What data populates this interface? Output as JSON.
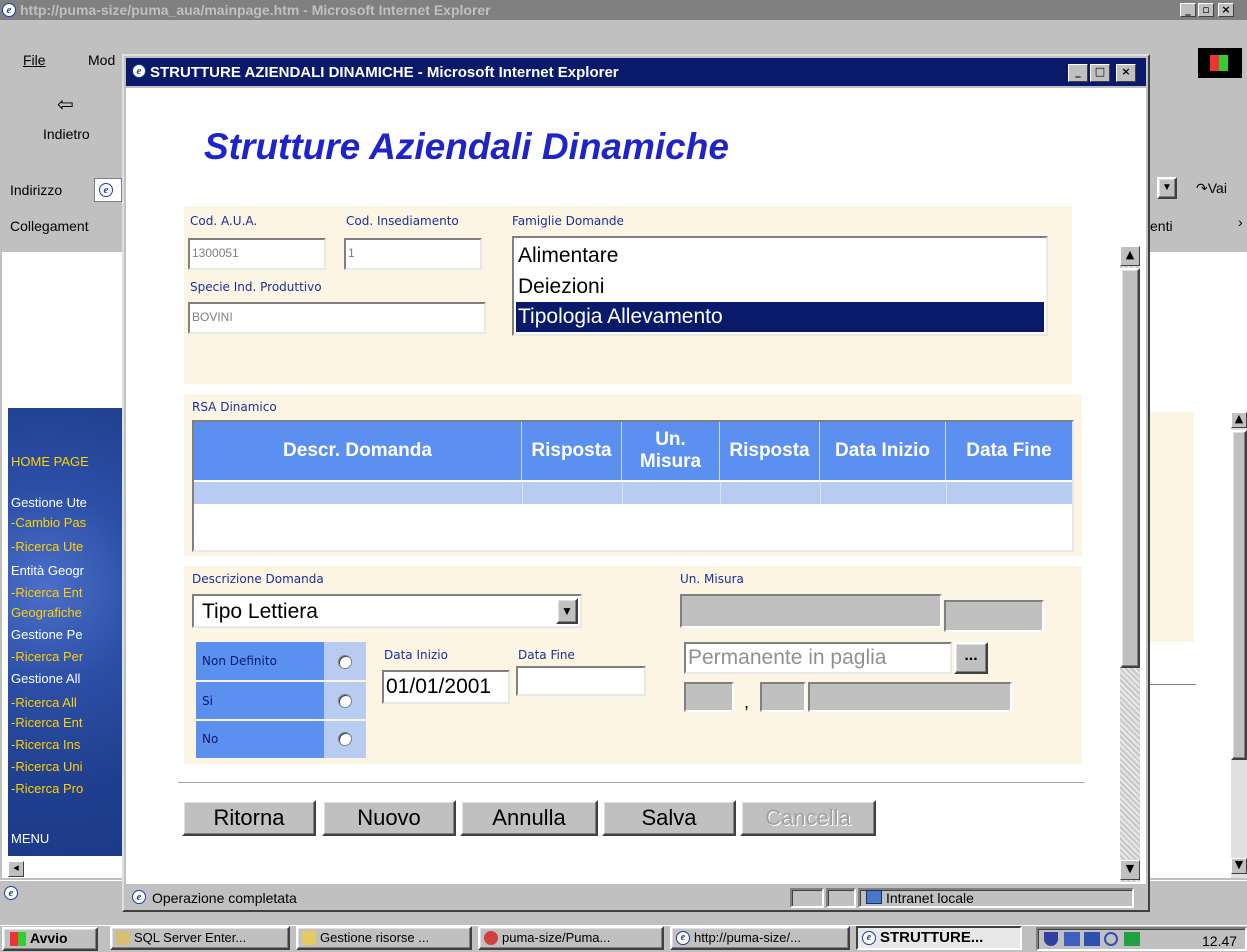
{
  "parent": {
    "title": "http://puma-size/puma_aua/mainpage.htm - Microsoft Internet Explorer",
    "menu_file": "File",
    "menu_mod": "Mod",
    "back_label": "Indietro",
    "address_label": "Indirizzo",
    "links_label": "Collegament",
    "links_right": "enti",
    "go_label": "Vai",
    "status_right": "12.47"
  },
  "sidebar": {
    "home": "HOME PAGE",
    "items": [
      {
        "text": "Gestione Ute",
        "kind": "text"
      },
      {
        "text": "-Cambio Pas",
        "kind": "link"
      },
      {
        "text": "-Ricerca Ute",
        "kind": "link"
      },
      {
        "text": "Entità Geogr",
        "kind": "text"
      },
      {
        "text": "-Ricerca Ent",
        "kind": "link"
      },
      {
        "text": "Geografiche",
        "kind": "link"
      },
      {
        "text": "Gestione Pe",
        "kind": "text"
      },
      {
        "text": "-Ricerca Per",
        "kind": "link"
      },
      {
        "text": "Gestione All",
        "kind": "text"
      },
      {
        "text": "-Ricerca All",
        "kind": "link"
      },
      {
        "text": "-Ricerca Ent",
        "kind": "link"
      },
      {
        "text": "-Ricerca Ins",
        "kind": "link"
      },
      {
        "text": "-Ricerca Uni",
        "kind": "link"
      },
      {
        "text": "-Ricerca Pro",
        "kind": "link"
      }
    ],
    "menu": "MENU"
  },
  "popup": {
    "title": "STRUTTURE AZIENDALI DINAMICHE - Microsoft Internet Explorer",
    "heading": "Strutture Aziendali Dinamiche",
    "cod_aua_label": "Cod. A.U.A.",
    "cod_aua_value": "1300051",
    "cod_ins_label": "Cod. Insediamento",
    "cod_ins_value": "1",
    "specie_label": "Specie Ind. Produttivo",
    "specie_value": "BOVINI",
    "famiglie_label": "Famiglie Domande",
    "famiglie": [
      "Alimentare",
      "Deiezioni",
      "Tipologia Allevamento"
    ],
    "famiglie_selected": "Tipologia Allevamento",
    "rsa_label": "RSA Dinamico",
    "table_headers": [
      "Descr. Domanda",
      "Risposta",
      "Un. Misura",
      "Risposta",
      "Data Inizio",
      "Data Fine"
    ],
    "descr_label": "Descrizione Domanda",
    "descr_value": "Tipo Lettiera",
    "unmisura_label": "Un. Misura",
    "radios": [
      "Non Definito",
      "Si",
      "No"
    ],
    "data_inizio_label": "Data Inizio",
    "data_inizio_value": "01/01/2001",
    "data_fine_label": "Data Fine",
    "data_fine_value": "",
    "risposta_value": "Permanente in paglia",
    "ellipsis": "...",
    "comma": ",",
    "buttons": {
      "ritorna": "Ritorna",
      "nuovo": "Nuovo",
      "annulla": "Annulla",
      "salva": "Salva",
      "cancella": "Cancella"
    },
    "status": "Operazione completata",
    "zone": "Intranet locale"
  },
  "taskbar": {
    "start": "Avvio",
    "tasks": [
      "SQL Server Enter...",
      "Gestione risorse ...",
      "puma-size/Puma...",
      "http://puma-size/...",
      "STRUTTURE..."
    ],
    "clock": "12.47"
  },
  "colors": {
    "title_active": "#0a1a6b",
    "title_inactive": "#808080",
    "heading": "#1f24c9",
    "table_header": "#5b8ff0",
    "table_row": "#b8cbf0",
    "form_bg": "#fdf5e3",
    "sidebar_link": "#ffd200",
    "selection": "#0a1a6b"
  }
}
